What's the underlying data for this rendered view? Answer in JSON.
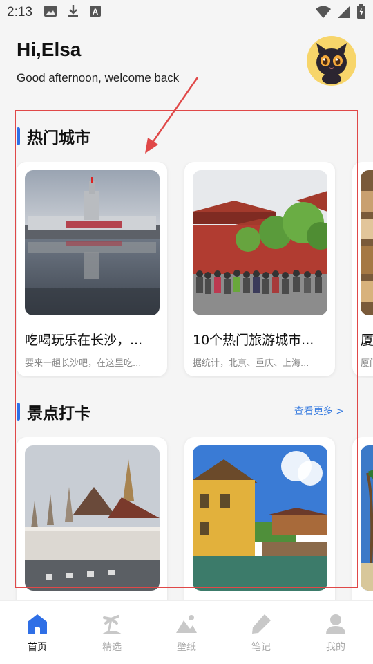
{
  "status_bar": {
    "time": "2:13"
  },
  "header": {
    "greeting": "Hi,Elsa",
    "subtitle": "Good afternoon, welcome back"
  },
  "hot_cities": {
    "title": "热门城市",
    "cards": [
      {
        "title": "吃喝玩乐在长沙，...",
        "desc": "要来一趟长沙吧，在这里吃..."
      },
      {
        "title": "10个热门旅游城市...",
        "desc": "据统计，北京、重庆、上海..."
      },
      {
        "title": "厦",
        "desc": "厦门"
      }
    ]
  },
  "attractions": {
    "title": "景点打卡",
    "see_more": "查看更多 >"
  },
  "bottom_nav": {
    "items": [
      {
        "label": "首页",
        "active": true
      },
      {
        "label": "精选",
        "active": false
      },
      {
        "label": "壁纸",
        "active": false
      },
      {
        "label": "笔记",
        "active": false
      },
      {
        "label": "我的",
        "active": false
      }
    ]
  },
  "colors": {
    "accent": "#2f6fe6",
    "annotation": "#e04848",
    "link": "#3a7de0"
  }
}
